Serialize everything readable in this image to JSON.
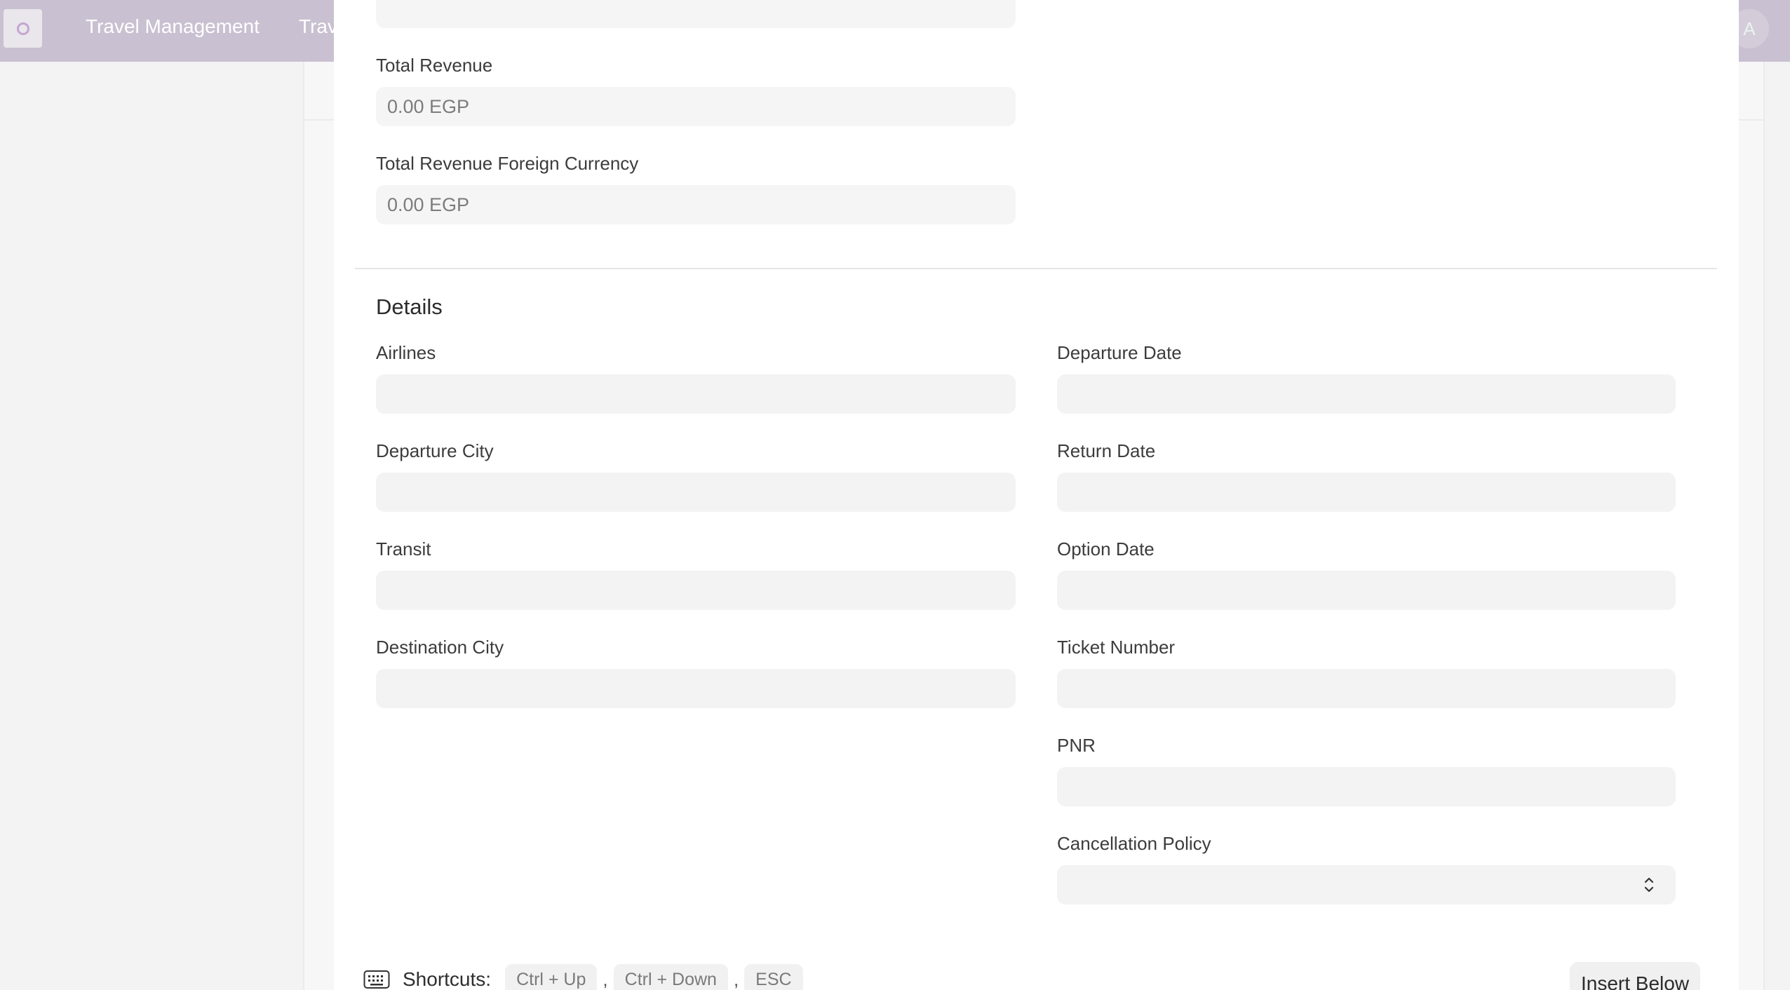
{
  "navbar": {
    "nav_links": [
      "Travel Management",
      "Trav"
    ],
    "avatar_initial": "A"
  },
  "form": {
    "total_revenue": {
      "label": "Total Revenue",
      "value": "0.00 EGP"
    },
    "total_revenue_foreign": {
      "label": "Total Revenue Foreign Currency",
      "value": "0.00 EGP"
    },
    "details": {
      "title": "Details",
      "airlines_label": "Airlines",
      "departure_city_label": "Departure City",
      "transit_label": "Transit",
      "destination_city_label": "Destination City",
      "departure_date_label": "Departure Date",
      "return_date_label": "Return Date",
      "option_date_label": "Option Date",
      "ticket_number_label": "Ticket Number",
      "pnr_label": "PNR",
      "cancellation_policy_label": "Cancellation Policy"
    }
  },
  "footer": {
    "shortcuts_label": "Shortcuts:",
    "keys": [
      "Ctrl + Up",
      "Ctrl + Down",
      "ESC"
    ],
    "insert_below_label": "Insert Below"
  },
  "icons": {
    "logo": "app-logo",
    "keyboard": "keyboard-icon",
    "select_arrows": "select-arrows-icon"
  }
}
